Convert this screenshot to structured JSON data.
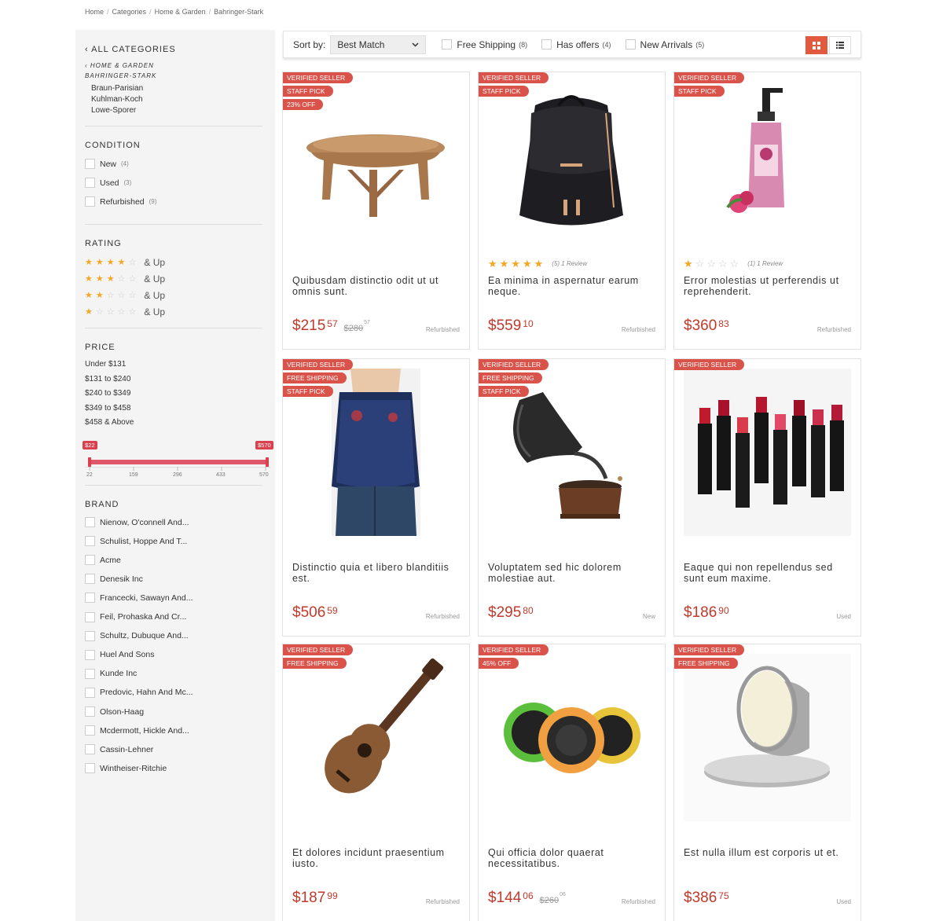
{
  "breadcrumb": [
    "Home",
    "Categories",
    "Home & Garden",
    "Bahringer-Stark"
  ],
  "sidebar": {
    "all_categories": "ALL CATEGORIES",
    "path_parent": "HOME & GARDEN",
    "path_current": "BAHRINGER-STARK",
    "subcategories": [
      "Braun-Parisian",
      "Kuhlman-Koch",
      "Lowe-Sporer"
    ],
    "condition_title": "CONDITION",
    "conditions": [
      {
        "label": "New",
        "count": "(4)"
      },
      {
        "label": "Used",
        "count": "(3)"
      },
      {
        "label": "Refurbished",
        "count": "(9)"
      }
    ],
    "rating_title": "RATING",
    "rating_suffix": "& Up",
    "ratings": [
      4,
      3,
      2,
      1
    ],
    "price_title": "PRICE",
    "price_ranges": [
      "Under $131",
      "$131 to $240",
      "$240 to $349",
      "$349 to $458",
      "$458 & Above"
    ],
    "slider": {
      "min_label": "$22",
      "max_label": "$570",
      "ticks": [
        "22",
        "159",
        "296",
        "433",
        "570"
      ],
      "range_min": 22,
      "range_max": 570
    },
    "brand_title": "BRAND",
    "brands": [
      "Nienow, O'connell And...",
      "Schulist, Hoppe And T...",
      "Acme",
      "Denesik Inc",
      "Francecki, Sawayn And...",
      "Feil, Prohaska And Cr...",
      "Schultz, Dubuque And...",
      "Huel And Sons",
      "Kunde Inc",
      "Predovic, Hahn And Mc...",
      "Olson-Haag",
      "Mcdermott, Hickle And...",
      "Cassin-Lehner",
      "Wintheiser-Ritchie"
    ]
  },
  "toolbar": {
    "sort_label": "Sort by:",
    "sort_value": "Best Match",
    "filters": [
      {
        "label": "Free Shipping",
        "count": "(8)"
      },
      {
        "label": "Has offers",
        "count": "(4)"
      },
      {
        "label": "New Arrivals",
        "count": "(5)"
      }
    ]
  },
  "colors": {
    "accent": "#e1593f",
    "badge": "#d9534a",
    "price": "#c0392b",
    "star": "#f5a623",
    "slider": "#e0566a"
  },
  "products": [
    {
      "badges": [
        "VERIFIED SELLER",
        "STAFF PICK",
        "23% OFF"
      ],
      "image": "table",
      "stars": 0,
      "reviews": "",
      "name": "Quibusdam distinctio odit ut ut omnis sunt.",
      "dollars": "$215",
      "cents": "57",
      "old_dollars": "$280",
      "old_cents": "57",
      "condition": "Refurbished"
    },
    {
      "badges": [
        "VERIFIED SELLER",
        "STAFF PICK"
      ],
      "image": "backpack",
      "stars": 5,
      "reviews": "(5) 1 Review",
      "name": "Ea minima in aspernatur earum neque.",
      "dollars": "$559",
      "cents": "10",
      "old_dollars": "",
      "old_cents": "",
      "condition": "Refurbished"
    },
    {
      "badges": [
        "VERIFIED SELLER",
        "STAFF PICK"
      ],
      "image": "soap",
      "stars": 1,
      "reviews": "(1) 1 Review",
      "name": "Error molestias ut perferendis ut reprehenderit.",
      "dollars": "$360",
      "cents": "83",
      "old_dollars": "",
      "old_cents": "",
      "condition": "Refurbished"
    },
    {
      "badges": [
        "VERIFIED SELLER",
        "FREE SHIPPING",
        "STAFF PICK"
      ],
      "image": "top",
      "stars": 0,
      "reviews": "",
      "name": "Distinctio quia et libero blanditiis est.",
      "dollars": "$506",
      "cents": "59",
      "old_dollars": "",
      "old_cents": "",
      "condition": "Refurbished"
    },
    {
      "badges": [
        "VERIFIED SELLER",
        "FREE SHIPPING",
        "STAFF PICK"
      ],
      "image": "gramophone",
      "stars": 0,
      "reviews": "",
      "name": "Voluptatem sed hic dolorem molestiae aut.",
      "dollars": "$295",
      "cents": "80",
      "old_dollars": "",
      "old_cents": "",
      "condition": "New"
    },
    {
      "badges": [
        "VERIFIED SELLER"
      ],
      "image": "lipsticks",
      "stars": 0,
      "reviews": "",
      "name": "Eaque qui non repellendus sed sunt eum maxime.",
      "dollars": "$186",
      "cents": "90",
      "old_dollars": "",
      "old_cents": "",
      "condition": "Used"
    },
    {
      "badges": [
        "VERIFIED SELLER",
        "FREE SHIPPING"
      ],
      "image": "ukulele",
      "stars": 0,
      "reviews": "",
      "name": "Et dolores incidunt praesentium iusto.",
      "dollars": "$187",
      "cents": "99",
      "old_dollars": "",
      "old_cents": "",
      "condition": "Refurbished"
    },
    {
      "badges": [
        "VERIFIED SELLER",
        "45% OFF"
      ],
      "image": "speakers",
      "stars": 0,
      "reviews": "",
      "name": "Qui officia dolor quaerat necessitatibus.",
      "dollars": "$144",
      "cents": "06",
      "old_dollars": "$260",
      "old_cents": "06",
      "condition": "Refurbished"
    },
    {
      "badges": [
        "VERIFIED SELLER",
        "FREE SHIPPING"
      ],
      "image": "tin",
      "stars": 0,
      "reviews": "",
      "name": "Est nulla illum est corporis ut et.",
      "dollars": "$386",
      "cents": "75",
      "old_dollars": "",
      "old_cents": "",
      "condition": "Used"
    }
  ]
}
